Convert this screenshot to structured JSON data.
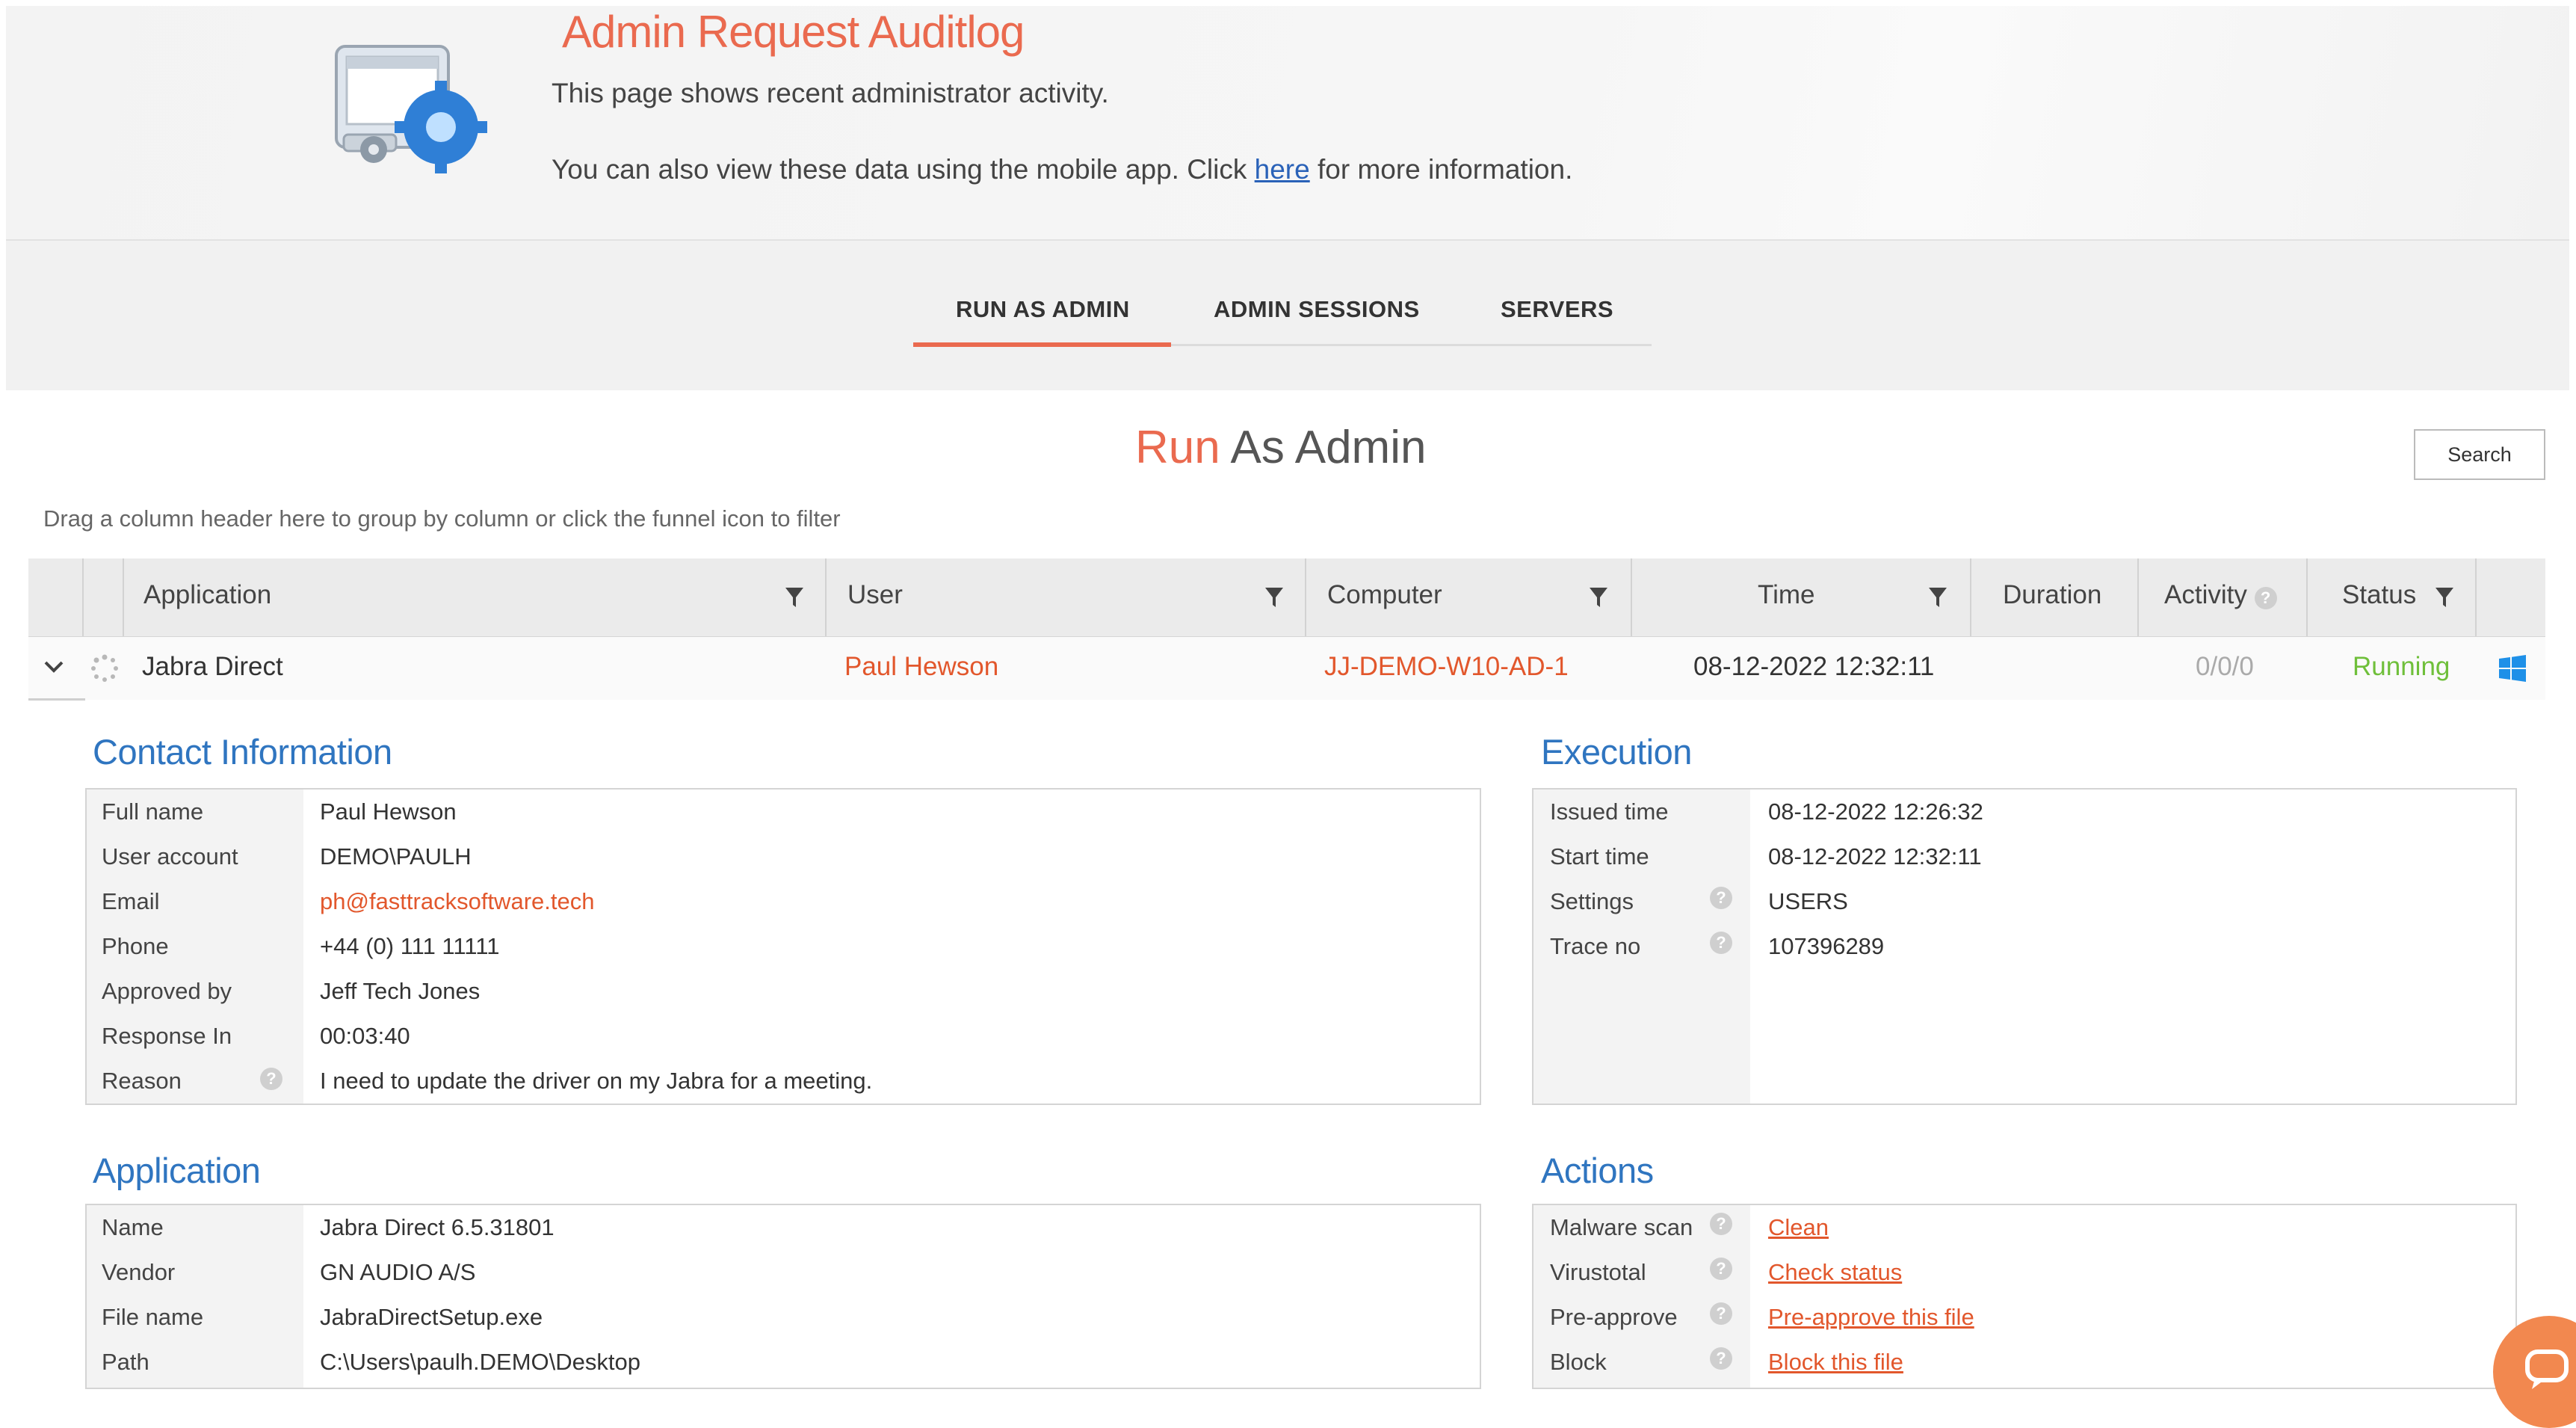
{
  "header": {
    "title": "Admin Request Auditlog",
    "subtitle": "This page shows recent administrator activity.",
    "mobile_prefix": "You can also view these data using the mobile app. Click ",
    "mobile_link": "here",
    "mobile_suffix": " for more information."
  },
  "tabs": [
    {
      "label": "RUN AS ADMIN",
      "active": true
    },
    {
      "label": "ADMIN SESSIONS",
      "active": false
    },
    {
      "label": "SERVERS",
      "active": false
    }
  ],
  "section": {
    "title_accent": "Run",
    "title_rest": " As Admin",
    "search_label": "Search",
    "drag_hint": "Drag a column header here to group by column or click the funnel icon to filter"
  },
  "grid": {
    "columns": [
      "Application",
      "User",
      "Computer",
      "Time",
      "Duration",
      "Activity",
      "Status"
    ],
    "row": {
      "application": "Jabra Direct",
      "user": "Paul Hewson",
      "computer": "JJ-DEMO-W10-AD-1",
      "time": "08-12-2022 12:32:11",
      "duration": "",
      "activity": "0/0/0",
      "status": "Running",
      "os_icon": "windows-icon"
    }
  },
  "contact": {
    "title": "Contact Information",
    "rows": [
      {
        "label": "Full name",
        "value": "Paul Hewson"
      },
      {
        "label": "User account",
        "value": "DEMO\\PAULH"
      },
      {
        "label": "Email",
        "value": "ph@fasttracksoftware.tech"
      },
      {
        "label": "Phone",
        "value": "+44 (0) 111 11111"
      },
      {
        "label": "Approved by",
        "value": "Jeff Tech Jones"
      },
      {
        "label": "Response In",
        "value": "00:03:40"
      },
      {
        "label": "Reason",
        "value": "I need to update the driver on my Jabra for a meeting."
      }
    ]
  },
  "execution": {
    "title": "Execution",
    "rows": [
      {
        "label": "Issued time",
        "value": "08-12-2022 12:26:32"
      },
      {
        "label": "Start time",
        "value": "08-12-2022 12:32:11"
      },
      {
        "label": "Settings",
        "value": "USERS"
      },
      {
        "label": "Trace no",
        "value": "107396289"
      }
    ]
  },
  "application": {
    "title": "Application",
    "rows": [
      {
        "label": "Name",
        "value": "Jabra Direct 6.5.31801"
      },
      {
        "label": "Vendor",
        "value": "GN AUDIO A/S"
      },
      {
        "label": "File name",
        "value": "JabraDirectSetup.exe"
      },
      {
        "label": "Path",
        "value": "C:\\Users\\paulh.DEMO\\Desktop"
      }
    ]
  },
  "actions": {
    "title": "Actions",
    "rows": [
      {
        "label": "Malware scan",
        "value": "Clean"
      },
      {
        "label": "Virustotal",
        "value": "Check status"
      },
      {
        "label": "Pre-approve",
        "value": "Pre-approve this file"
      },
      {
        "label": "Block",
        "value": "Block this file"
      }
    ]
  },
  "colors": {
    "accent": "#ea6a4f",
    "link_blue": "#2a62b8",
    "panel_title": "#2f75c0",
    "running": "#6fbf3a"
  }
}
